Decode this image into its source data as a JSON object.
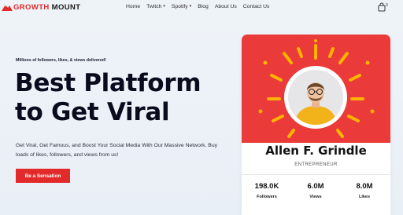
{
  "brand": {
    "part1": "GROWTH",
    "part2": "MOUNT",
    "accent": "#e32a2a"
  },
  "nav": {
    "items": [
      {
        "label": "Home",
        "dropdown": false
      },
      {
        "label": "Twitch",
        "dropdown": true
      },
      {
        "label": "Spotify",
        "dropdown": true
      },
      {
        "label": "Blog",
        "dropdown": false
      },
      {
        "label": "About Us",
        "dropdown": false
      },
      {
        "label": "Contact Us",
        "dropdown": false
      }
    ],
    "cart_icon": "shopping-bag-icon",
    "cart_count": "0"
  },
  "hero": {
    "eyebrow": "Millions of followers, likes, & views delivered!",
    "title_line1": "Best Platform",
    "title_line2": "to Get Viral",
    "description": "Get Viral, Get Famous, and Boost Your Social Media With Our Massive Network. Buy loads of likes, followers, and views from us!",
    "cta_label": "Be a Sensation"
  },
  "profile_card": {
    "name": "Allen F. Grindle",
    "role": "ENTREPRENEUR",
    "header_color": "#eb3a3a",
    "ray_color": "#ffb400",
    "stats": [
      {
        "value": "198.0K",
        "label": "Followers"
      },
      {
        "value": "6.0M",
        "label": "Views"
      },
      {
        "value": "8.0M",
        "label": "Likes"
      }
    ]
  }
}
